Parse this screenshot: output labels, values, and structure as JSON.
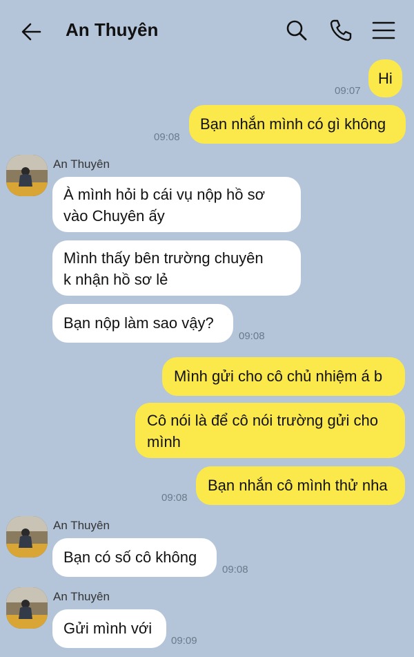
{
  "header": {
    "title": "An Thuyên",
    "back_icon": "arrow-left-icon",
    "search_icon": "search-icon",
    "call_icon": "phone-icon",
    "menu_icon": "hamburger-menu-icon"
  },
  "colors": {
    "background": "#b4c5d9",
    "my_bubble": "#fbe84b",
    "their_bubble": "#ffffff"
  },
  "messages": [
    {
      "from": "me",
      "text": "Hi",
      "time": "09:07"
    },
    {
      "from": "me",
      "text": "Bạn nhắn mình có gì không",
      "time": "09:08"
    },
    {
      "from": "An Thuyên",
      "sender_name": "An Thuyên",
      "text_lines": [
        "À mình hỏi b cái vụ nộp hồ sơ",
        "vào Chuyên ấy"
      ]
    },
    {
      "from": "An Thuyên",
      "text_lines": [
        "Mình thấy bên trường chuyên",
        "k nhận hồ sơ lẻ"
      ]
    },
    {
      "from": "An Thuyên",
      "text": "Bạn nộp làm sao vậy?",
      "time": "09:08"
    },
    {
      "from": "me",
      "text": "Mình gửi cho cô chủ nhiệm á b"
    },
    {
      "from": "me",
      "text_lines": [
        "Cô nói là để cô nói trường gửi cho",
        "mình"
      ]
    },
    {
      "from": "me",
      "text": "Bạn nhắn cô mình thử nha",
      "time": "09:08"
    },
    {
      "from": "An Thuyên",
      "sender_name": "An Thuyên",
      "text": "Bạn có số cô không",
      "time": "09:08"
    },
    {
      "from": "An Thuyên",
      "sender_name": "An Thuyên",
      "text": "Gửi mình với",
      "time": "09:09"
    }
  ]
}
